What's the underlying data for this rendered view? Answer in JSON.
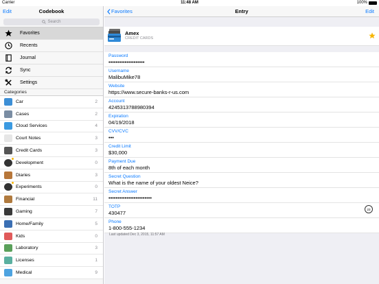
{
  "status": {
    "carrier": "Carrier",
    "time": "11:48 AM",
    "battery": "100%"
  },
  "sidebar": {
    "edit_label": "Edit",
    "title": "Codebook",
    "search_placeholder": "Search",
    "nav": [
      {
        "label": "Favorites",
        "icon": "star-icon"
      },
      {
        "label": "Recents",
        "icon": "clock-icon"
      },
      {
        "label": "Journal",
        "icon": "notebook-icon"
      },
      {
        "label": "Sync",
        "icon": "sync-icon"
      },
      {
        "label": "Settings",
        "icon": "wrench-icon"
      }
    ],
    "categories_header": "Categories",
    "categories": [
      {
        "label": "Car",
        "count": "2",
        "color": "#3d8fd6"
      },
      {
        "label": "Cases",
        "count": "2",
        "color": "#7a8da3"
      },
      {
        "label": "Cloud Services",
        "count": "4",
        "color": "#3b9ae1"
      },
      {
        "label": "Court Notes",
        "count": "3",
        "color": "#e6e6e6"
      },
      {
        "label": "Credit Cards",
        "count": "3",
        "color": "#555555"
      },
      {
        "label": "Development",
        "count": "0",
        "color": "#333333"
      },
      {
        "label": "Diaries",
        "count": "3",
        "color": "#b7773a"
      },
      {
        "label": "Experiments",
        "count": "0",
        "color": "#333333"
      },
      {
        "label": "Financial",
        "count": "11",
        "color": "#b07a3e"
      },
      {
        "label": "Gaming",
        "count": "7",
        "color": "#3a3a3a"
      },
      {
        "label": "Home/Family",
        "count": "5",
        "color": "#3b6fb3"
      },
      {
        "label": "Kids",
        "count": "0",
        "color": "#e05a5a"
      },
      {
        "label": "Laboratory",
        "count": "3",
        "color": "#5aa05a"
      },
      {
        "label": "Licenses",
        "count": "1",
        "color": "#5ab0a0"
      },
      {
        "label": "Medical",
        "count": "9",
        "color": "#4da3e0"
      }
    ]
  },
  "main": {
    "back_label": "Favorites",
    "title": "Entry",
    "edit_label": "Edit",
    "entry": {
      "name": "Amex",
      "category": "CREDIT CARDS"
    },
    "fields": [
      {
        "label": "Password",
        "value": "••••••••••••••••••••"
      },
      {
        "label": "Username",
        "value": "MalibuMike78"
      },
      {
        "label": "Website",
        "value": "https://www.secure-banks-r-us.com"
      },
      {
        "label": "Account",
        "value": "4245313788980394"
      },
      {
        "label": "Expiration",
        "value": "04/19/2018"
      },
      {
        "label": "CVV/CVC",
        "value": "•••"
      },
      {
        "label": "Credit Limit",
        "value": "$30,000"
      },
      {
        "label": "Payment Due",
        "value": "8th of each month"
      },
      {
        "label": "Secret Question",
        "value": "What is the name of your oldest Neice?"
      },
      {
        "label": "Secret Answer",
        "value": "••••••••••••••••••••••••"
      },
      {
        "label": "TOTP",
        "value": "430477"
      },
      {
        "label": "Phone",
        "value": "1-800-555-1234"
      }
    ],
    "totp_seconds": "23",
    "last_updated": "Last updated Dec 3, 2015, 11:57 AM"
  },
  "colors": {
    "accent": "#0a7aff",
    "star": "#f7b500"
  }
}
